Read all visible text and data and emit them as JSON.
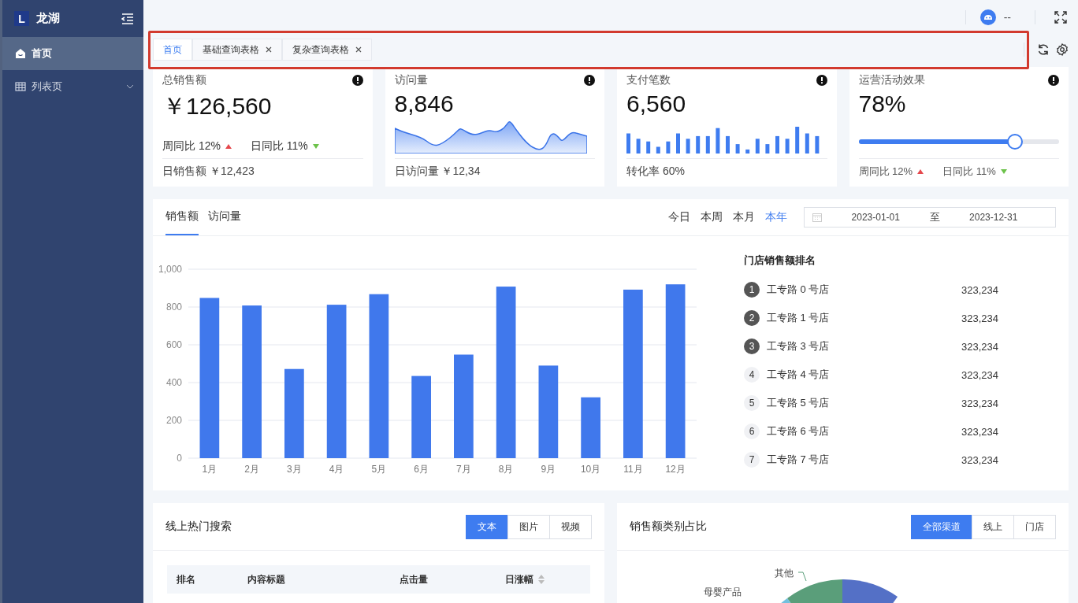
{
  "sidebar": {
    "logo_mark": "L",
    "brand": "龙湖",
    "items": [
      {
        "label": "首页",
        "selected": true,
        "expandable": false
      },
      {
        "label": "列表页",
        "selected": false,
        "expandable": true
      }
    ]
  },
  "header": {
    "user": "--"
  },
  "tabs": [
    {
      "label": "首页",
      "selected": true,
      "closable": false
    },
    {
      "label": "基础查询表格",
      "selected": false,
      "closable": true
    },
    {
      "label": "复杂查询表格",
      "selected": false,
      "closable": true
    }
  ],
  "stat_cards": [
    {
      "kind": "trend",
      "title": "总销售额",
      "value": "￥126,560",
      "trends": [
        {
          "label": "周同比 12%",
          "kind": "up"
        },
        {
          "label": "日同比 11%",
          "kind": "down"
        }
      ],
      "footer": "日销售额 ￥12,423"
    },
    {
      "kind": "area",
      "title": "访问量",
      "value": "8,846",
      "footer": "日访问量 ￥12,34"
    },
    {
      "kind": "bars",
      "title": "支付笔数",
      "value": "6,560",
      "footer": "转化率 60%"
    },
    {
      "kind": "progress",
      "title": "运营活动效果",
      "value": "78%",
      "level": 0.78,
      "trends": [
        {
          "label": "周同比 12%",
          "kind": "up"
        },
        {
          "label": "日同比 11%",
          "kind": "down"
        }
      ]
    }
  ],
  "sales": {
    "tabs": [
      {
        "label": "销售额",
        "selected": true
      },
      {
        "label": "访问量",
        "selected": false
      }
    ],
    "ranges": [
      {
        "label": "今日",
        "selected": false
      },
      {
        "label": "本周",
        "selected": false
      },
      {
        "label": "本月",
        "selected": false
      },
      {
        "label": "本年",
        "selected": true
      }
    ],
    "date_start": "2023-01-01",
    "date_separator": "至",
    "date_end": "2023-12-31",
    "chart_data": {
      "type": "bar",
      "categories": [
        "1月",
        "2月",
        "3月",
        "4月",
        "5月",
        "6月",
        "7月",
        "8月",
        "9月",
        "10月",
        "11月",
        "12月"
      ],
      "values": [
        848,
        808,
        472,
        812,
        868,
        435,
        548,
        908,
        490,
        322,
        892,
        920
      ],
      "grid": true,
      "ylim": [
        0,
        1000
      ],
      "yticks": [
        0,
        200,
        400,
        600,
        800,
        {
          "value": 1000,
          "label": "1,000"
        }
      ]
    },
    "ranking_title": "门店销售额排名",
    "ranking": [
      {
        "rank": "1",
        "name": "工专路 0 号店",
        "value": "323,234",
        "top": true
      },
      {
        "rank": "2",
        "name": "工专路 1 号店",
        "value": "323,234",
        "top": true
      },
      {
        "rank": "3",
        "name": "工专路 3 号店",
        "value": "323,234",
        "top": true
      },
      {
        "rank": "4",
        "name": "工专路 4 号店",
        "value": "323,234",
        "top": false
      },
      {
        "rank": "5",
        "name": "工专路 5 号店",
        "value": "323,234",
        "top": false
      },
      {
        "rank": "6",
        "name": "工专路 6 号店",
        "value": "323,234",
        "top": false
      },
      {
        "rank": "7",
        "name": "工专路 7 号店",
        "value": "323,234",
        "top": false
      }
    ]
  },
  "hot_search": {
    "title": "线上热门搜索",
    "segments": [
      {
        "label": "文本",
        "selected": true
      },
      {
        "label": "图片",
        "selected": false
      },
      {
        "label": "视频",
        "selected": false
      }
    ],
    "columns": [
      {
        "label": "排名",
        "sortable": false
      },
      {
        "label": "内容标题",
        "sortable": false
      },
      {
        "label": "点击量",
        "sortable": false
      },
      {
        "label": "日涨幅",
        "sortable": true
      }
    ]
  },
  "category_share": {
    "title": "销售额类别占比",
    "segments": [
      {
        "label": "全部渠道",
        "selected": true
      },
      {
        "label": "线上",
        "selected": false
      },
      {
        "label": "门店",
        "selected": false
      }
    ],
    "pie_labels": [
      "其他",
      "母婴产品"
    ]
  }
}
